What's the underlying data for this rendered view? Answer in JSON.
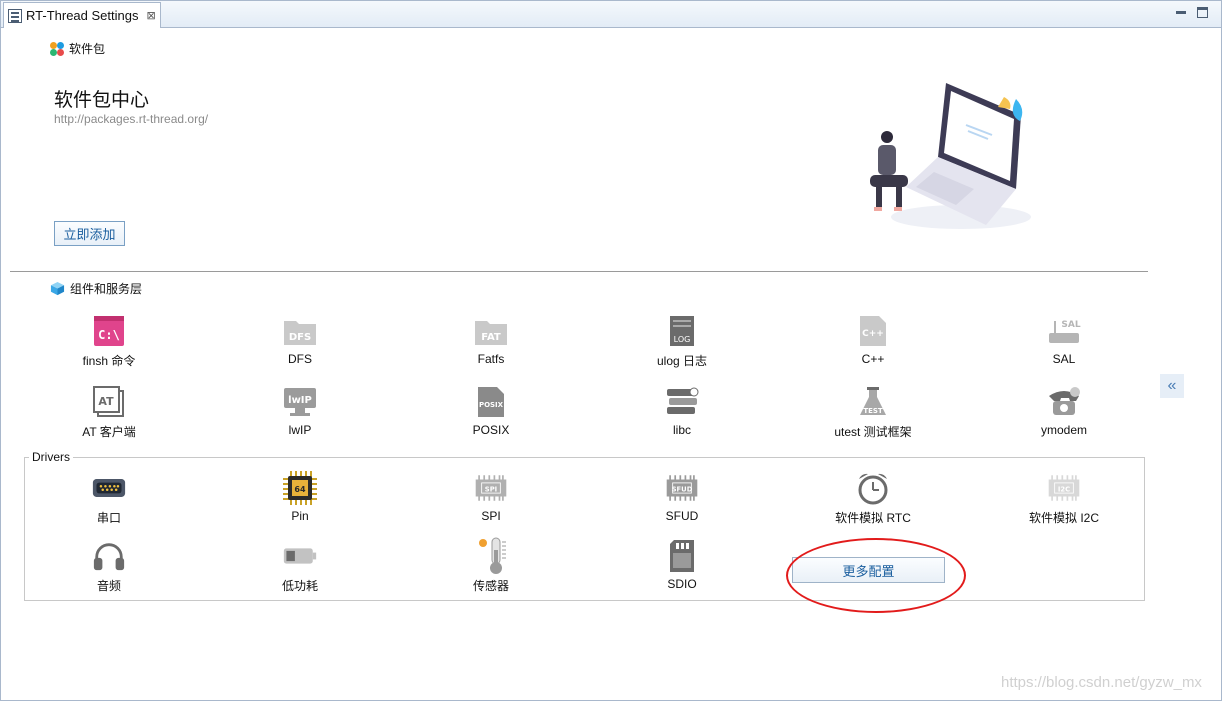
{
  "tab": {
    "title": "RT-Thread Settings",
    "close": "⊠"
  },
  "packages": {
    "section_label": "软件包",
    "title": "软件包中心",
    "url": "http://packages.rt-thread.org/",
    "add_button": "立即添加"
  },
  "components": {
    "section_label": "组件和服务层",
    "items": [
      {
        "label": "finsh 命令",
        "icon": "terminal-icon",
        "glyph": "C:\\"
      },
      {
        "label": "DFS",
        "icon": "folder-dfs-icon",
        "glyph": "DFS"
      },
      {
        "label": "Fatfs",
        "icon": "folder-fat-icon",
        "glyph": "FAT"
      },
      {
        "label": "ulog 日志",
        "icon": "log-file-icon",
        "glyph": "LOG"
      },
      {
        "label": "C++",
        "icon": "cpp-file-icon",
        "glyph": "C++"
      },
      {
        "label": "SAL",
        "icon": "router-icon",
        "glyph": "SAL"
      },
      {
        "label": "AT 客户端",
        "icon": "at-icon",
        "glyph": "AT"
      },
      {
        "label": "lwIP",
        "icon": "monitor-lwip-icon",
        "glyph": "lwIP"
      },
      {
        "label": "POSIX",
        "icon": "posix-file-icon",
        "glyph": "POSIX"
      },
      {
        "label": "libc",
        "icon": "books-icon",
        "glyph": "libc"
      },
      {
        "label": "utest 测试框架",
        "icon": "flask-icon",
        "glyph": "TEST"
      },
      {
        "label": "ymodem",
        "icon": "telephone-icon",
        "glyph": "☎"
      }
    ]
  },
  "drivers": {
    "group_label": "Drivers",
    "items": [
      {
        "label": "串口",
        "icon": "serial-port-icon",
        "glyph": "•••••"
      },
      {
        "label": "Pin",
        "icon": "chip-icon",
        "glyph": "64"
      },
      {
        "label": "SPI",
        "icon": "spi-chip-icon",
        "glyph": "SPI"
      },
      {
        "label": "SFUD",
        "icon": "sfud-chip-icon",
        "glyph": "SFUD"
      },
      {
        "label": "软件模拟 RTC",
        "icon": "alarm-clock-icon",
        "glyph": "⏰"
      },
      {
        "label": "软件模拟 I2C",
        "icon": "i2c-chip-icon",
        "glyph": "I2C"
      },
      {
        "label": "音频",
        "icon": "headphones-icon",
        "glyph": "🎧"
      },
      {
        "label": "低功耗",
        "icon": "battery-icon",
        "glyph": ""
      },
      {
        "label": "传感器",
        "icon": "thermometer-icon",
        "glyph": ""
      },
      {
        "label": "SDIO",
        "icon": "sd-card-icon",
        "glyph": ""
      }
    ],
    "more_button": "更多配置"
  },
  "collapse_button": "«",
  "watermark": "https://blog.csdn.net/gyzw_mx"
}
